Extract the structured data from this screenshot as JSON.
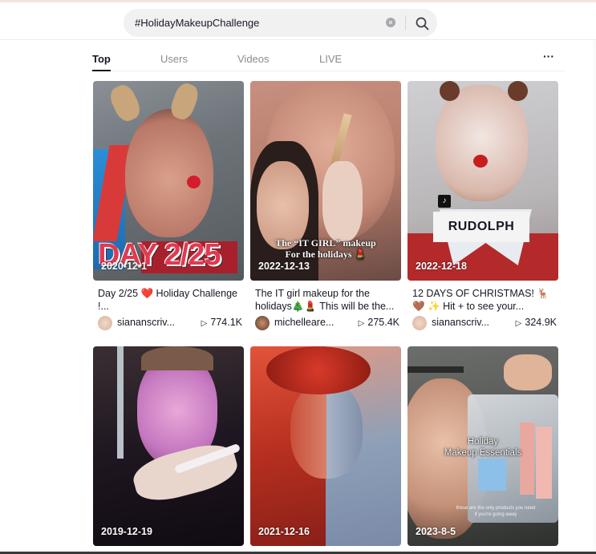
{
  "search": {
    "value": "#HolidayMakeupChallenge",
    "clear_icon": "clear-icon",
    "search_icon": "search-icon"
  },
  "tabs": [
    {
      "label": "Top",
      "active": true
    },
    {
      "label": "Users",
      "active": false
    },
    {
      "label": "Videos",
      "active": false
    },
    {
      "label": "LIVE",
      "active": false
    }
  ],
  "more_label": "···",
  "videos": [
    {
      "date": "2020-12-1",
      "overlay": "DAY 2/25",
      "description": "Day 2/25 ❤️ Holiday Challenge !...",
      "username": "siananscriv...",
      "views": "774.1K"
    },
    {
      "date": "2022-12-13",
      "overlay": "The “IT GIRL” makeup\nFor the holidays 💄",
      "description": "The IT girl makeup for the holidays🎄💄 This will be the...",
      "username": "michelleare...",
      "views": "275.4K"
    },
    {
      "date": "2022-12-18",
      "overlay": "RUDOLPH",
      "description": "12 DAYS OF CHRISTMAS! 🦌 🤎 ✨ Hit + to see your...",
      "username": "siananscriv...",
      "views": "324.9K"
    },
    {
      "date": "2019-12-19",
      "overlay": "",
      "description": "",
      "username": "",
      "views": ""
    },
    {
      "date": "2021-12-16",
      "overlay": "",
      "description": "",
      "username": "",
      "views": ""
    },
    {
      "date": "2023-8-5",
      "overlay": "Holiday\nMakeup Essentials",
      "caption_small": "these are the only products you need if you're going away",
      "description": "",
      "username": "",
      "views": ""
    }
  ],
  "view_icon": "play-icon",
  "colors": {
    "text_primary": "#161823",
    "text_secondary": "#8a8b91",
    "search_bg": "#f1f1f2"
  }
}
